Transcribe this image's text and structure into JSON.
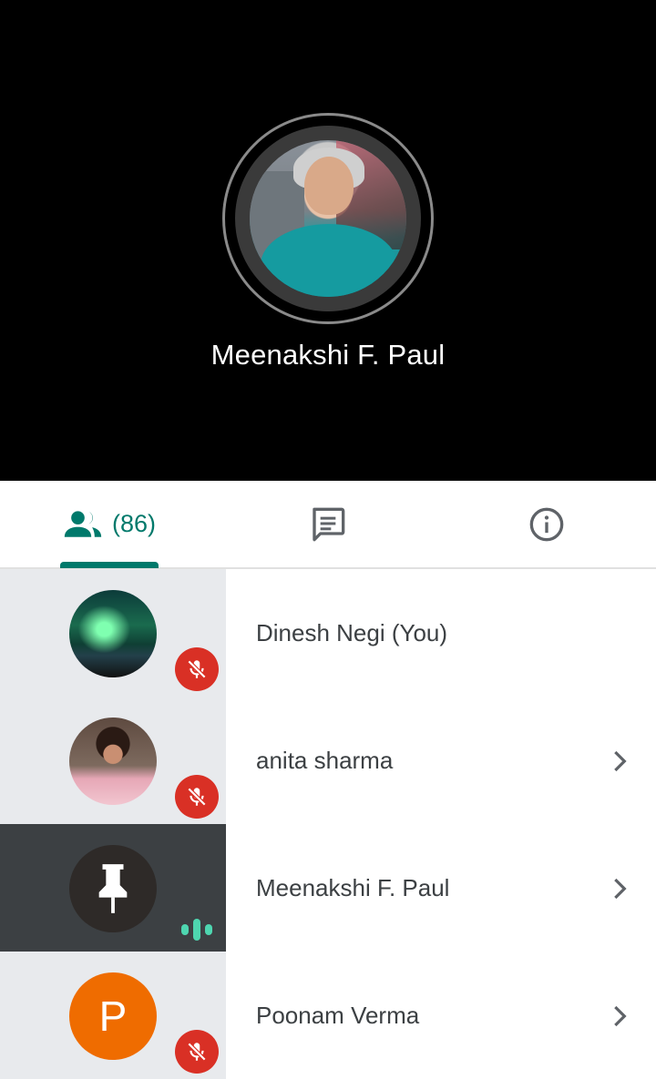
{
  "stage": {
    "speaker_name": "Meenakshi F. Paul"
  },
  "tabs": {
    "people_count": "(86)",
    "accent_color": "#00796b",
    "items": [
      {
        "icon": "people-icon",
        "selected": true
      },
      {
        "icon": "chat-icon",
        "selected": false
      },
      {
        "icon": "info-icon",
        "selected": false
      }
    ]
  },
  "participants": [
    {
      "name": "Dinesh Negi (You)",
      "avatar": "aurora-photo",
      "status": "muted",
      "chevron": false
    },
    {
      "name": "anita sharma",
      "avatar": "photo",
      "status": "muted",
      "chevron": true
    },
    {
      "name": "Meenakshi F. Paul",
      "avatar": "photo-pinned",
      "status": "speaking",
      "chevron": true,
      "pinned": true
    },
    {
      "name": "Poonam Verma",
      "avatar_initial": "P",
      "avatar_color": "#ef6c00",
      "status": "muted",
      "chevron": true
    }
  ],
  "colors": {
    "muted_badge": "#d93025",
    "speaking_indicator": "#4ed6b0",
    "tile_bg": "#e8eaed",
    "active_tile_bg": "#3c4043"
  }
}
